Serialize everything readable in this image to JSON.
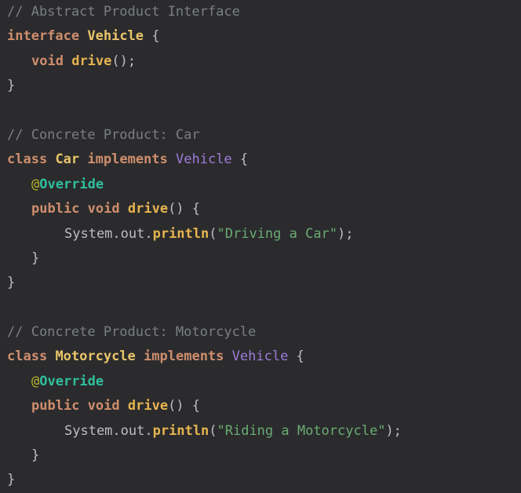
{
  "code": {
    "l1_comment": "// Abstract Product Interface",
    "l2_kw": "interface",
    "l2_name": "Vehicle",
    "l2_brace": " {",
    "l3_kw": "void",
    "l3_fn": "drive",
    "l3_rest": "();",
    "l4": "}",
    "l6_comment": "// Concrete Product: Car",
    "l7_kw": "class",
    "l7_name": "Car",
    "l7_impl": "implements",
    "l7_iface": "Vehicle",
    "l7_brace": " {",
    "l8_at": "@",
    "l8_ann": "Override",
    "l9_kw1": "public",
    "l9_kw2": "void",
    "l9_fn": "drive",
    "l9_rest": "() {",
    "l10_obj": "System.out.",
    "l10_fn": "println",
    "l10_open": "(",
    "l10_str": "\"Driving a Car\"",
    "l10_close": ");",
    "l11": "}",
    "l12": "}",
    "l14_comment": "// Concrete Product: Motorcycle",
    "l15_kw": "class",
    "l15_name": "Motorcycle",
    "l15_impl": "implements",
    "l15_iface": "Vehicle",
    "l15_brace": " {",
    "l16_at": "@",
    "l16_ann": "Override",
    "l17_kw1": "public",
    "l17_kw2": "void",
    "l17_fn": "drive",
    "l17_rest": "() {",
    "l18_obj": "System.out.",
    "l18_fn": "println",
    "l18_open": "(",
    "l18_str": "\"Riding a Motorcycle\"",
    "l18_close": ");",
    "l19": "}",
    "l20": "}"
  },
  "colors": {
    "background": "#2b2b2d",
    "comment": "#7a7e85",
    "keyword": "#cf8e6d",
    "type_name": "#e9c46a",
    "interface_ref": "#9d7cd8",
    "method": "#e6b450",
    "annotation": "#2fbf9d",
    "string": "#6aab73",
    "plain": "#bcbec4"
  }
}
